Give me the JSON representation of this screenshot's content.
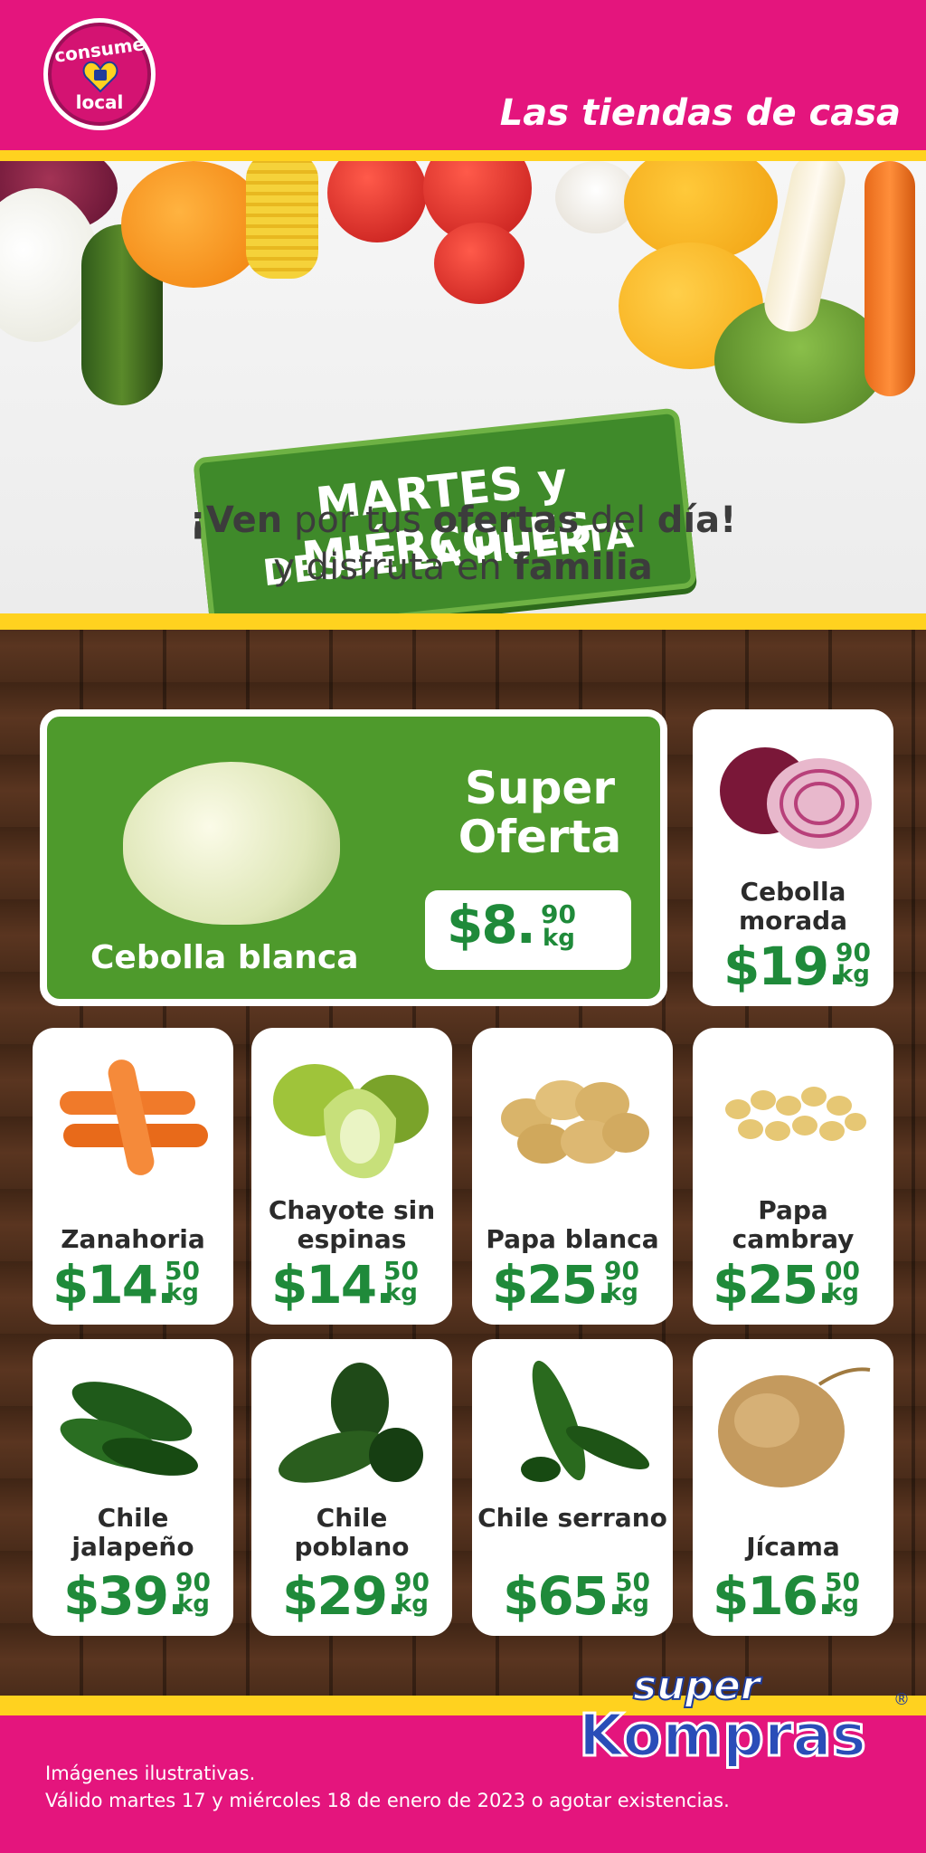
{
  "header": {
    "logo_text_top": "consume",
    "logo_text_bottom": "local",
    "tagline": "Las tiendas de casa"
  },
  "hero": {
    "banner_line1": "MARTES y MIÉRCOLES",
    "banner_line2": "DESDE LA HUERTA",
    "sub_line1_a": "¡",
    "sub_line1_b": "Ven",
    "sub_line1_c": " por tus ",
    "sub_line1_d": "ofertas",
    "sub_line1_e": " del ",
    "sub_line1_f": "día!",
    "sub_line2_a": "y disfruta en ",
    "sub_line2_b": "familia"
  },
  "feature": {
    "name": "Cebolla blanca",
    "label": "Super Oferta",
    "price_int": "$8.",
    "price_dec": "90",
    "unit": "kg"
  },
  "products": [
    {
      "name": "Cebolla morada",
      "int": "$19.",
      "dec": "90",
      "unit": "kg"
    },
    {
      "name": "Zanahoria",
      "int": "$14.",
      "dec": "50",
      "unit": "kg"
    },
    {
      "name": "Chayote sin espinas",
      "int": "$14.",
      "dec": "50",
      "unit": "kg"
    },
    {
      "name": "Papa blanca",
      "int": "$25.",
      "dec": "90",
      "unit": "kg"
    },
    {
      "name": "Papa cambray",
      "int": "$25.",
      "dec": "00",
      "unit": "kg"
    },
    {
      "name": "Chile jalapeño",
      "int": "$39.",
      "dec": "90",
      "unit": "kg"
    },
    {
      "name": "Chile poblano",
      "int": "$29.",
      "dec": "90",
      "unit": "kg"
    },
    {
      "name": "Chile serrano",
      "int": "$65.",
      "dec": "50",
      "unit": "kg"
    },
    {
      "name": "Jícama",
      "int": "$16.",
      "dec": "50",
      "unit": "kg"
    }
  ],
  "brand": {
    "super": "super",
    "name": "Kompras",
    "registered": "®"
  },
  "footer": {
    "legal_line1": "Imágenes ilustrativas.",
    "legal_line2": "Válido martes 17 y miércoles 18 de enero de 2023 o agotar existencias."
  },
  "colors": {
    "magenta": "#e4157d",
    "yellow": "#ffd21f",
    "green": "#4e9a2c",
    "price_green": "#1f8a3a"
  }
}
